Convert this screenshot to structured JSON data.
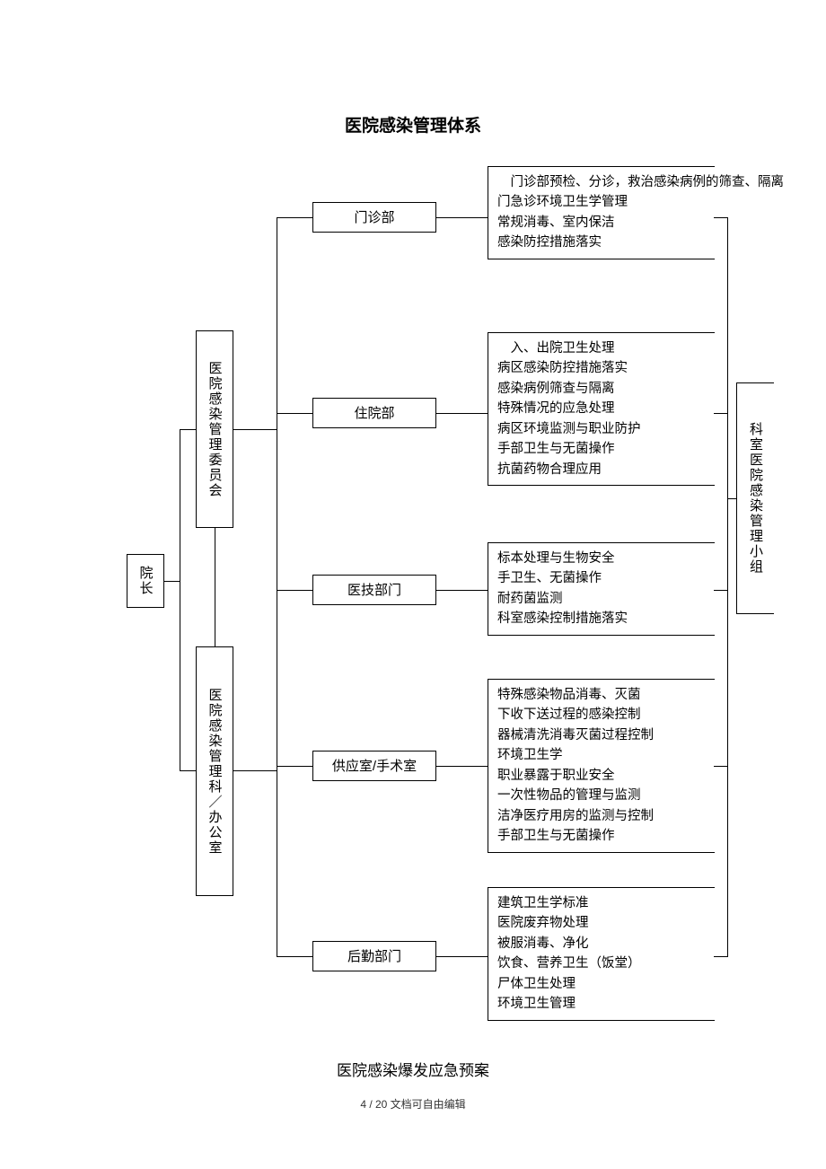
{
  "title": "医院感染管理体系",
  "subtitle": "医院感染爆发应急预案",
  "footer": "4 / 20 文档可自由编辑",
  "root": "院长",
  "level2": {
    "a": "医院感染管理委员会",
    "b": "医院感染管理科／办公室"
  },
  "rightcol": "科室医院感染管理小组",
  "depts": {
    "d1": {
      "name": "门诊部",
      "items": [
        "　门诊部预检、分诊，救治感染病例的筛查、隔离",
        "门急诊环境卫生学管理",
        "常规消毒、室内保洁",
        "感染防控措施落实"
      ]
    },
    "d2": {
      "name": "住院部",
      "items": [
        "　入、出院卫生处理",
        "病区感染防控措施落实",
        "感染病例筛查与隔离",
        "特殊情况的应急处理",
        "病区环境监测与职业防护",
        "手部卫生与无菌操作",
        "抗菌药物合理应用"
      ]
    },
    "d3": {
      "name": "医技部门",
      "items": [
        "标本处理与生物安全",
        "手卫生、无菌操作",
        "耐药菌监测",
        "科室感染控制措施落实"
      ]
    },
    "d4": {
      "name": "供应室/手术室",
      "items": [
        "特殊感染物品消毒、灭菌",
        "下收下送过程的感染控制",
        "器械清洗消毒灭菌过程控制",
        "环境卫生学",
        "职业暴露于职业安全",
        "一次性物品的管理与监测",
        "洁净医疗用房的监测与控制",
        "手部卫生与无菌操作"
      ]
    },
    "d5": {
      "name": "后勤部门",
      "items": [
        "建筑卫生学标准",
        "医院废弃物处理",
        "被服消毒、净化",
        "饮食、营养卫生（饭堂）",
        "尸体卫生处理",
        "环境卫生管理"
      ]
    }
  }
}
